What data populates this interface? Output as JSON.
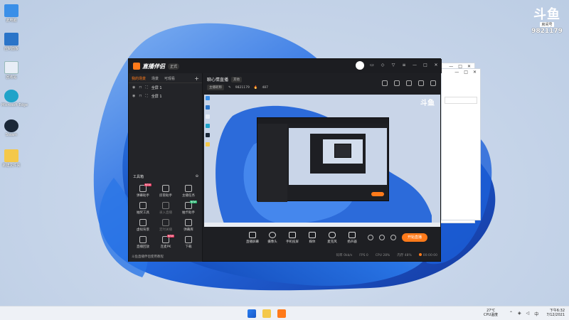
{
  "desktop": {
    "icons": [
      {
        "label": "此电脑",
        "icon": "computer-icon",
        "color": "#3a8fe8"
      },
      {
        "label": "控制面板",
        "icon": "control-panel-icon",
        "color": "#2a74c8"
      },
      {
        "label": "回收站",
        "icon": "recycle-bin-icon",
        "color": "#e8eef6"
      },
      {
        "label": "Microsoft Edge",
        "icon": "edge-icon",
        "color": "#1fa3c9"
      },
      {
        "label": "Steam",
        "icon": "steam-icon",
        "color": "#1b2838"
      },
      {
        "label": "新建文件夹",
        "icon": "folder-icon",
        "color": "#f4c84a"
      }
    ],
    "douyu": {
      "big": "斗鱼",
      "small": "房间号",
      "room": "9821179"
    }
  },
  "app": {
    "name": "直播伴侣",
    "version": "正式",
    "tabs": [
      "我的场景",
      "场景",
      "可观看"
    ],
    "add_label": "+",
    "scenes": [
      "全屏 1",
      "全屏 1"
    ],
    "tools_title": "工具箱",
    "tools": [
      {
        "label": "弹幕助手",
        "tag": "NEW",
        "dim": false
      },
      {
        "label": "房管助手",
        "tag": "",
        "dim": false
      },
      {
        "label": "主播任务",
        "tag": "",
        "dim": false
      },
      {
        "label": "抽奖工具",
        "tag": "",
        "dim": false
      },
      {
        "label": "录入直播",
        "tag": "",
        "dim": true
      },
      {
        "label": "抽卡助手",
        "tag": "NEW",
        "dim": false
      },
      {
        "label": "虚拟背景",
        "tag": "",
        "dim": false
      },
      {
        "label": "定时关播",
        "tag": "",
        "dim": true
      },
      {
        "label": "弹幕库",
        "tag": "",
        "dim": false
      },
      {
        "label": "直播回放",
        "tag": "",
        "dim": false
      },
      {
        "label": "连麦PK",
        "tag": "NEW",
        "dim": false
      },
      {
        "label": "下载",
        "tag": "",
        "dim": false
      }
    ],
    "left_footer": "斗鱼直播伴侣使用教程",
    "stream_title": "聊心情直播",
    "stream_category": "其他",
    "stream_info": {
      "anchor": "主播昵称",
      "room": "9821179",
      "viewers": "487"
    },
    "controls": [
      "直播屏幕",
      "摄像头",
      "手机投屏",
      "媒体",
      "麦克风",
      "扬声器"
    ],
    "go_live": "开始直播",
    "status": {
      "bitrate": "码率 0kb/s",
      "fps": "FPS 0",
      "cpu": "CPU 28%",
      "mem": "内存 48%",
      "time": "00:00:00"
    },
    "preview_logo": "斗鱼"
  },
  "bg_window": {
    "controls": [
      "—",
      "□",
      "✕"
    ]
  },
  "taskbar": {
    "weather_temp": "27℃",
    "weather_label": "CPU温度",
    "time": "下午6:32",
    "date": "7/12/2021"
  }
}
